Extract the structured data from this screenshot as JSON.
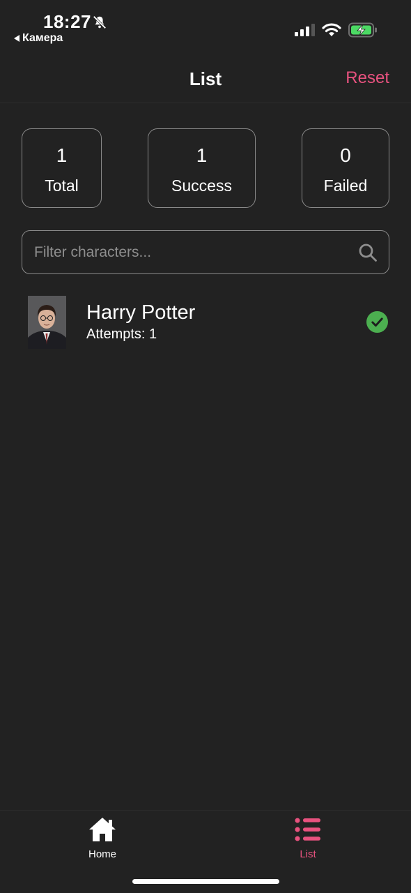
{
  "status_bar": {
    "time": "18:27",
    "back_app": "Камера",
    "icons": [
      "bell-slash-icon",
      "signal-icon",
      "wifi-icon",
      "battery-charging-icon"
    ]
  },
  "header": {
    "title": "List",
    "reset_label": "Reset"
  },
  "stats": [
    {
      "value": "1",
      "label": "Total"
    },
    {
      "value": "1",
      "label": "Success"
    },
    {
      "value": "0",
      "label": "Failed"
    }
  ],
  "search": {
    "placeholder": "Filter characters...",
    "value": ""
  },
  "list": {
    "items": [
      {
        "name": "Harry Potter",
        "attempts": "Attempts: 1",
        "status": "success"
      }
    ]
  },
  "tabs": [
    {
      "label": "Home",
      "icon": "home-icon",
      "active": false
    },
    {
      "label": "List",
      "icon": "list-icon",
      "active": true
    }
  ],
  "colors": {
    "background": "#222222",
    "accent": "#e8527f",
    "success": "#4caf50",
    "border": "#8a8a8a"
  }
}
